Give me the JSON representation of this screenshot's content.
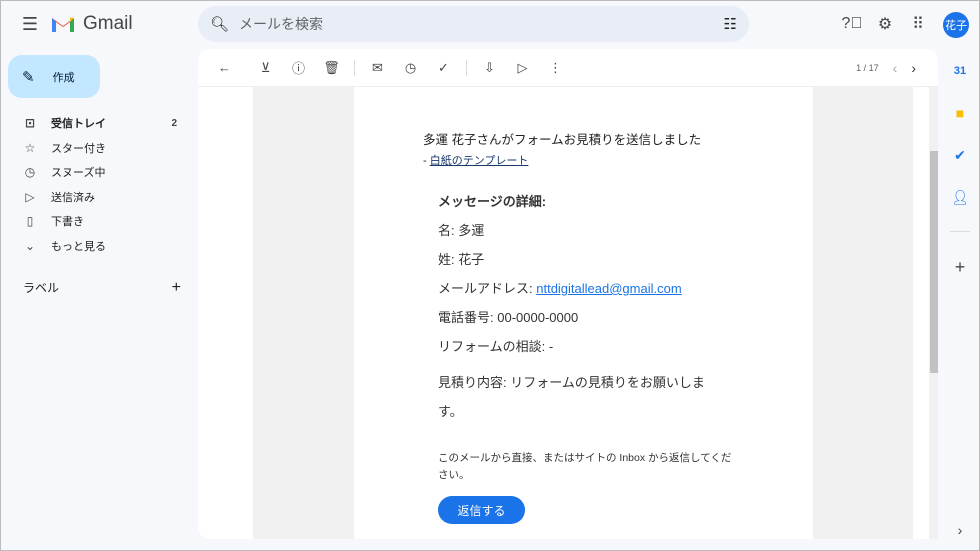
{
  "header": {
    "app_name": "Gmail",
    "search_placeholder": "メールを検索",
    "avatar_text": "花子"
  },
  "sidebar": {
    "compose_label": "作成",
    "items": [
      {
        "label": "受信トレイ",
        "count": "2",
        "icon": "inbox-icon"
      },
      {
        "label": "スター付き",
        "icon": "star-icon"
      },
      {
        "label": "スヌーズ中",
        "icon": "clock-icon"
      },
      {
        "label": "送信済み",
        "icon": "send-icon"
      },
      {
        "label": "下書き",
        "icon": "draft-icon"
      },
      {
        "label": "もっと見る",
        "icon": "chevron-down-icon"
      }
    ],
    "labels_heading": "ラベル"
  },
  "toolbar": {
    "pager": "1 / 17"
  },
  "email": {
    "subject_line": "多運 花子さんがフォームお見積りを送信しました",
    "template_prefix": "- ",
    "template_link": "白紙のテンプレート",
    "details_heading": "メッセージの詳細:",
    "fields": [
      {
        "label": "名: ",
        "value": "多運"
      },
      {
        "label": "姓: ",
        "value": "花子"
      },
      {
        "label": "メールアドレス: ",
        "value": "nttdigitallead@gmail.com"
      },
      {
        "label": "電話番号: ",
        "value": "00-0000-0000"
      },
      {
        "label": "リフォームの相談: ",
        "value": "-"
      },
      {
        "label": "見積り内容: ",
        "value": "リフォームの見積りをお願いします。"
      }
    ],
    "note": "このメールから直接、またはサイトの Inbox から返信してください。",
    "reply_label": "返信する"
  },
  "colors": {
    "accent": "#1a73e8",
    "compose_bg": "#c2e7ff",
    "sidebar_bg": "#f6f8fc"
  }
}
